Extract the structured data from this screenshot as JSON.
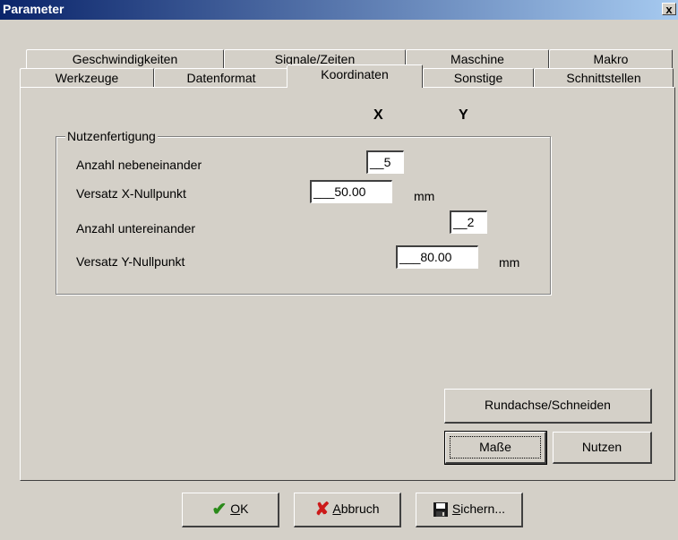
{
  "window": {
    "title": "Parameter",
    "close_glyph": "x"
  },
  "tabs_row1": [
    {
      "label": "Geschwindigkeiten"
    },
    {
      "label": "Signale/Zeiten"
    },
    {
      "label": "Maschine"
    },
    {
      "label": "Makro"
    }
  ],
  "tabs_row2": [
    {
      "label": "Werkzeuge"
    },
    {
      "label": "Datenformat"
    },
    {
      "label": "Koordinaten",
      "active": true
    },
    {
      "label": "Sonstige"
    },
    {
      "label": "Schnittstellen"
    }
  ],
  "columns": {
    "x": "X",
    "y": "Y"
  },
  "group": {
    "title": "Nutzenfertigung",
    "rows": [
      {
        "label": "Anzahl nebeneinander",
        "value": "__5"
      },
      {
        "label": "Versatz X-Nullpunkt",
        "value": "___50.00",
        "unit": "mm"
      },
      {
        "label": "Anzahl untereinander",
        "value": "__2"
      },
      {
        "label": "Versatz Y-Nullpunkt",
        "value": "___80.00",
        "unit": "mm"
      }
    ]
  },
  "buttons": {
    "rundachse": "Rundachse/Schneiden",
    "masse": "Maße",
    "nutzen": "Nutzen",
    "ok_first": "O",
    "ok_rest": "K",
    "abbruch_first": "A",
    "abbruch_rest": "bbruch",
    "sichern_first": "S",
    "sichern_rest": "ichern..."
  },
  "icons": {
    "ok": "check-icon",
    "abbruch": "x-icon",
    "sichern": "floppy-disk-icon"
  },
  "colors": {
    "title_start": "#0a246a",
    "title_end": "#a6caf0",
    "face": "#d4d0c8",
    "check": "#2a8a1a",
    "cross": "#cc1a1a"
  }
}
